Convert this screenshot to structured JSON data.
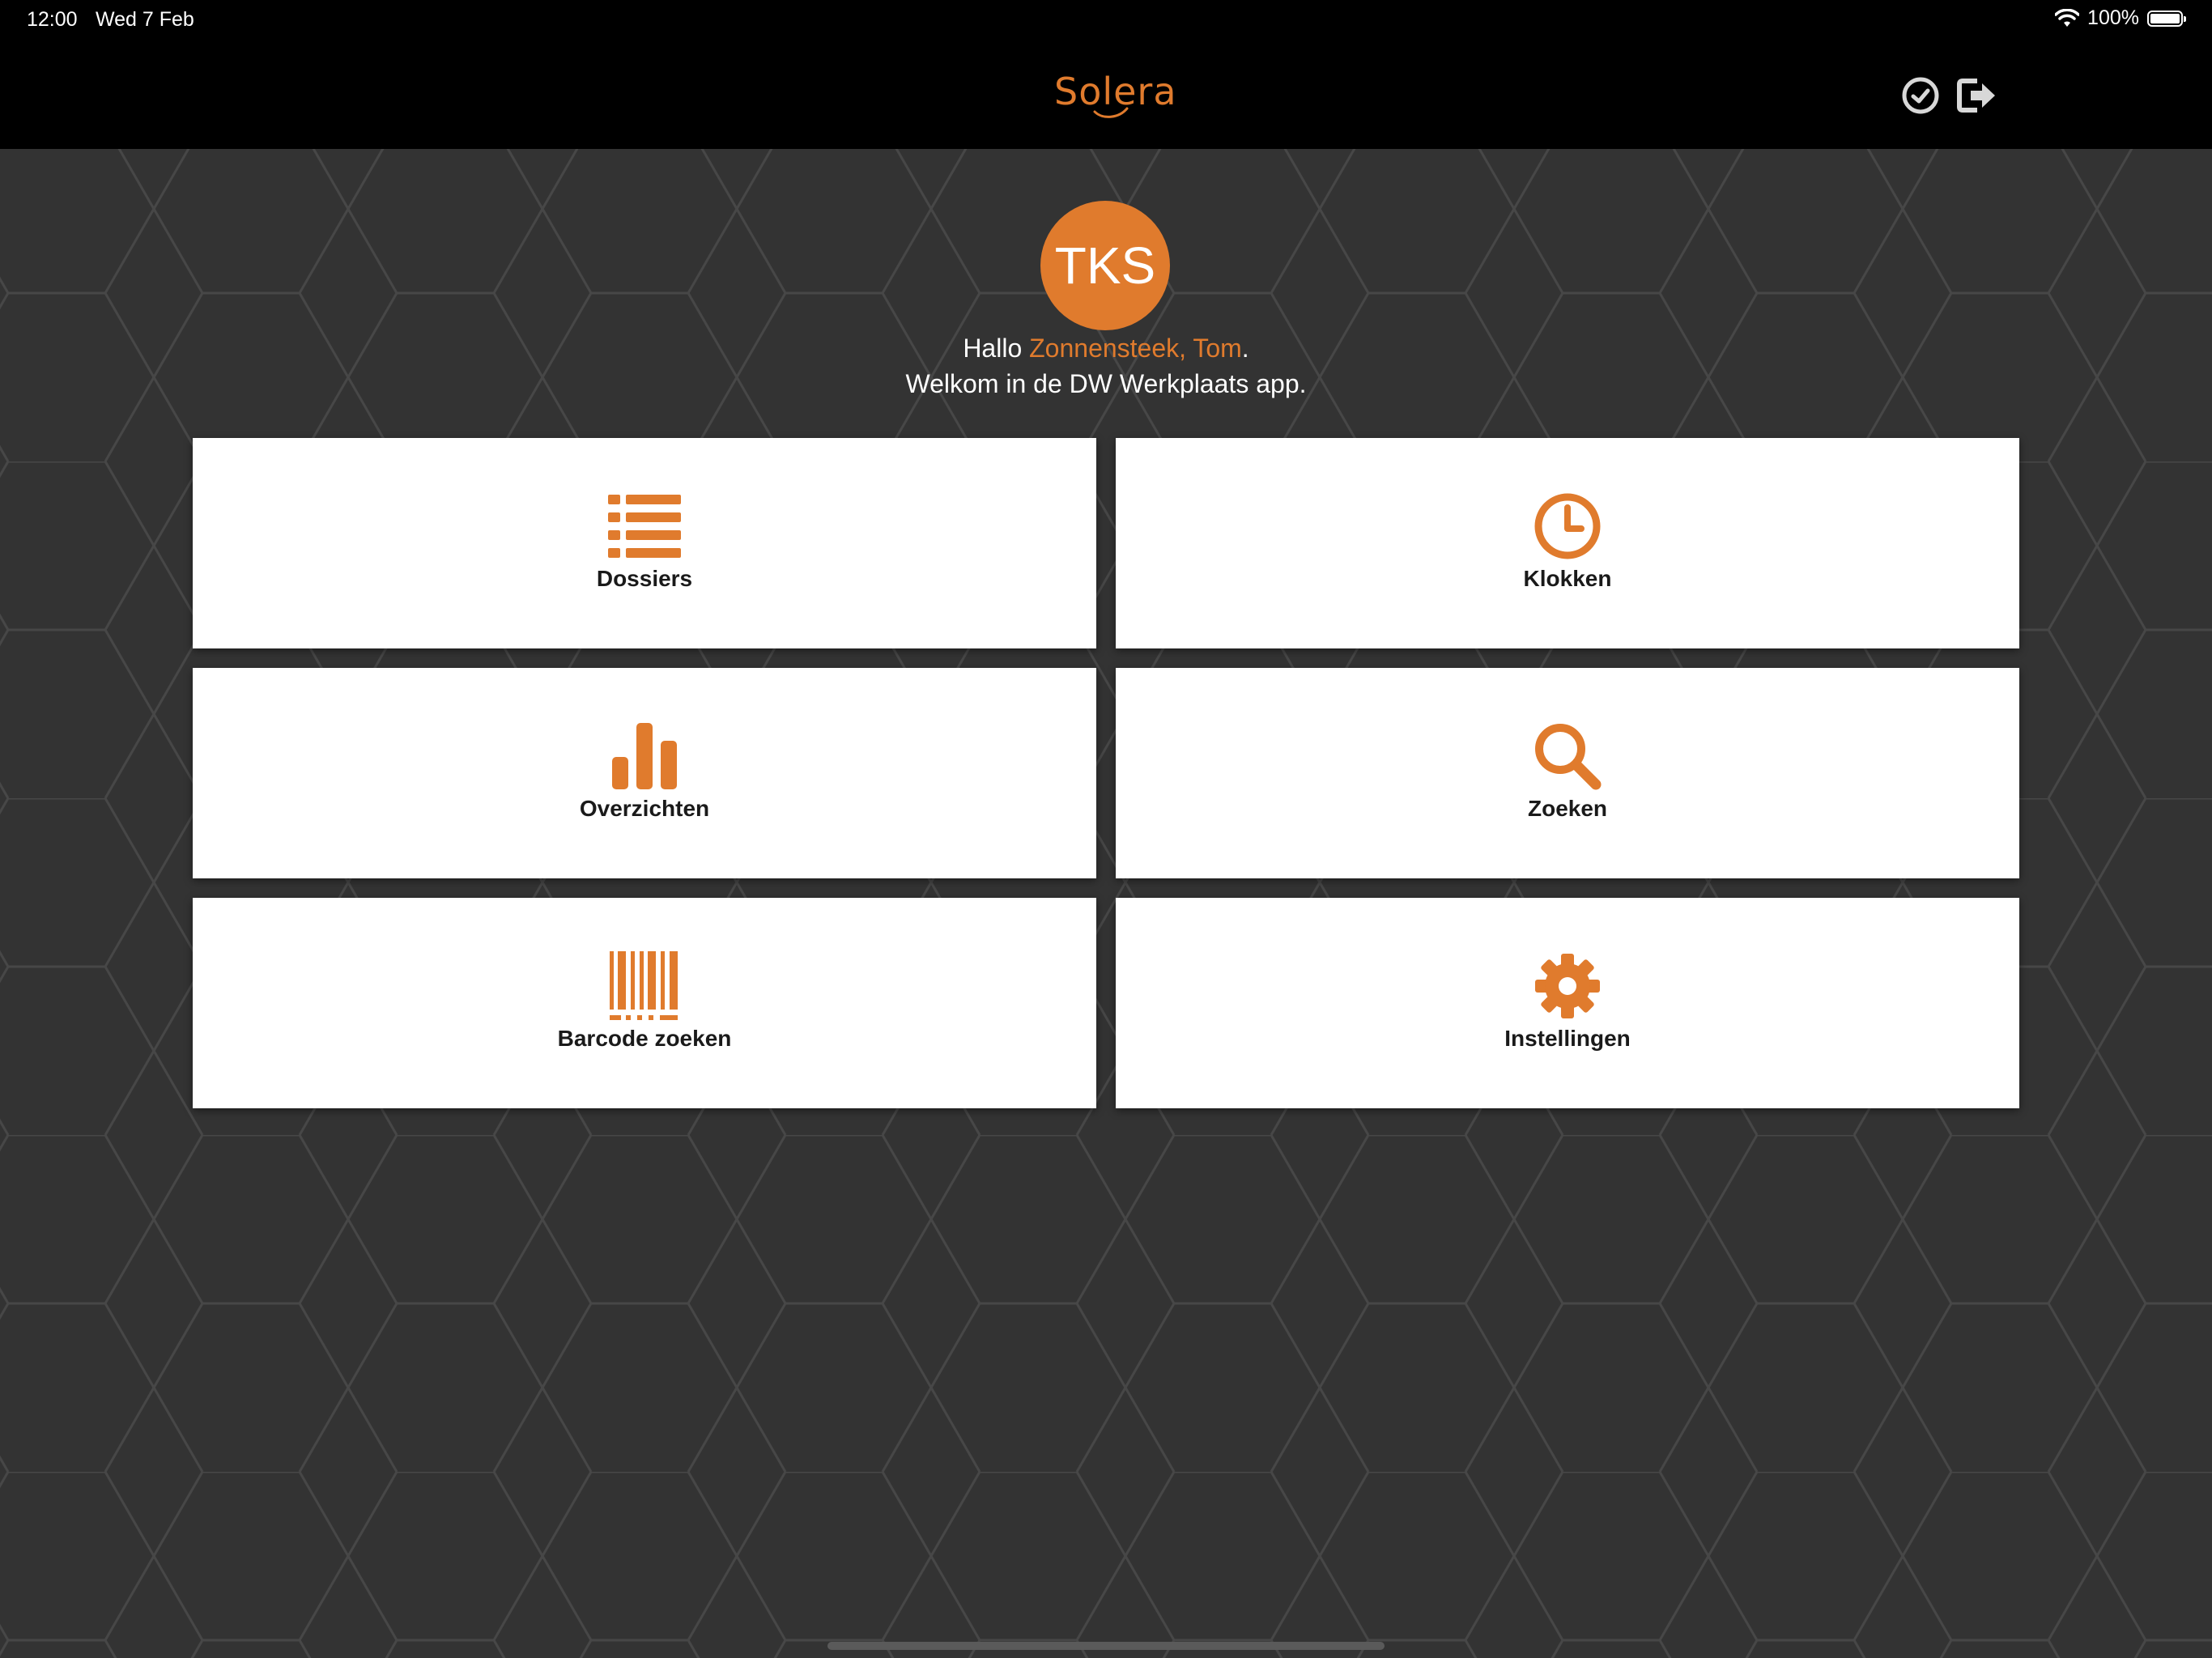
{
  "status_bar": {
    "time": "12:00",
    "date": "Wed 7 Feb",
    "battery": "100%"
  },
  "nav": {
    "logo": "Solera"
  },
  "user": {
    "initials": "TKS",
    "greeting_prefix": "Hallo ",
    "name": "Zonnensteek, Tom",
    "greeting_suffix": ".",
    "welcome": "Welkom in de DW Werkplaats app."
  },
  "tiles": [
    {
      "label": "Dossiers",
      "icon": "list-icon"
    },
    {
      "label": "Klokken",
      "icon": "clock-icon"
    },
    {
      "label": "Overzichten",
      "icon": "bar-chart-icon"
    },
    {
      "label": "Zoeken",
      "icon": "search-icon"
    },
    {
      "label": "Barcode zoeken",
      "icon": "barcode-icon"
    },
    {
      "label": "Instellingen",
      "icon": "gear-icon"
    }
  ],
  "colors": {
    "accent": "#e07b2d",
    "background": "#333333",
    "bar": "#000000",
    "tile": "#ffffff"
  }
}
